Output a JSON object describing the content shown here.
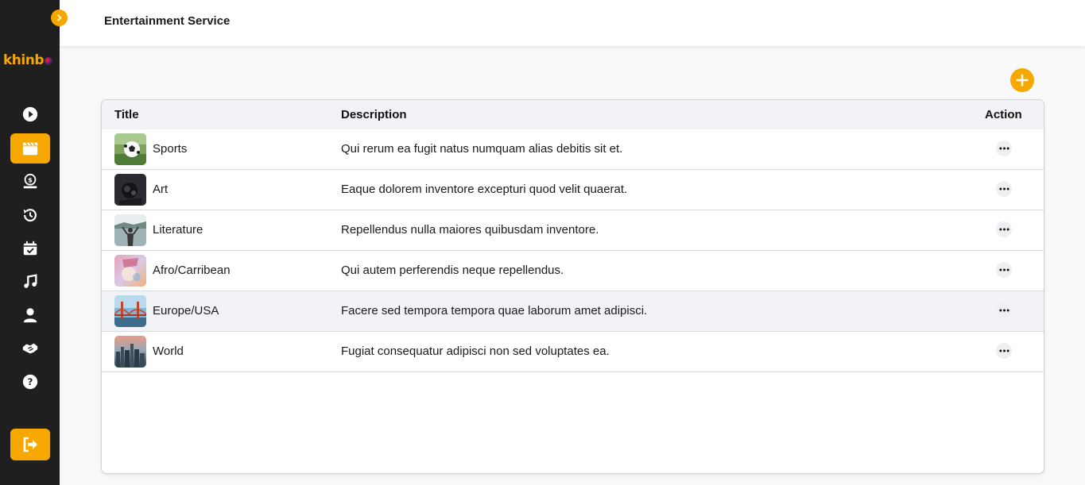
{
  "header": {
    "title": "Entertainment Service"
  },
  "brand": {
    "logo_text": "khinb",
    "accent": "#f7a800",
    "sidebar_bg": "#1f1f1f"
  },
  "sidebar": {
    "items": [
      {
        "icon": "play-circle-icon",
        "active": false
      },
      {
        "icon": "clapperboard-icon",
        "active": true
      },
      {
        "icon": "money-hand-icon",
        "active": false
      },
      {
        "icon": "history-icon",
        "active": false
      },
      {
        "icon": "calendar-check-icon",
        "active": false
      },
      {
        "icon": "music-icon",
        "active": false
      },
      {
        "icon": "user-icon",
        "active": false
      },
      {
        "icon": "handshake-icon",
        "active": false
      },
      {
        "icon": "help-icon",
        "active": false
      }
    ],
    "logout_icon": "logout-icon"
  },
  "table": {
    "columns": {
      "title": "Title",
      "description": "Description",
      "action": "Action"
    },
    "rows": [
      {
        "title": "Sports",
        "description": "Qui rerum ea fugit natus numquam alias debitis sit et.",
        "thumb": "soccer-ball-on-grass"
      },
      {
        "title": "Art",
        "description": "Eaque dolorem inventore excepturi quod velit quaerat.",
        "thumb": "dark-sculpture"
      },
      {
        "title": "Literature",
        "description": "Repellendus nulla maiores quibusdam inventore.",
        "thumb": "person-by-lake"
      },
      {
        "title": "Afro/Carribean",
        "description": "Qui autem perferendis neque repellendus.",
        "thumb": "colorful-portrait"
      },
      {
        "title": "Europe/USA",
        "description": "Facere sed tempora tempora quae laborum amet adipisci.",
        "thumb": "golden-gate-bridge",
        "highlighted": true
      },
      {
        "title": "World",
        "description": "Fugiat consequatur adipisci non sed voluptates ea.",
        "thumb": "city-skyline-sunset"
      }
    ]
  }
}
